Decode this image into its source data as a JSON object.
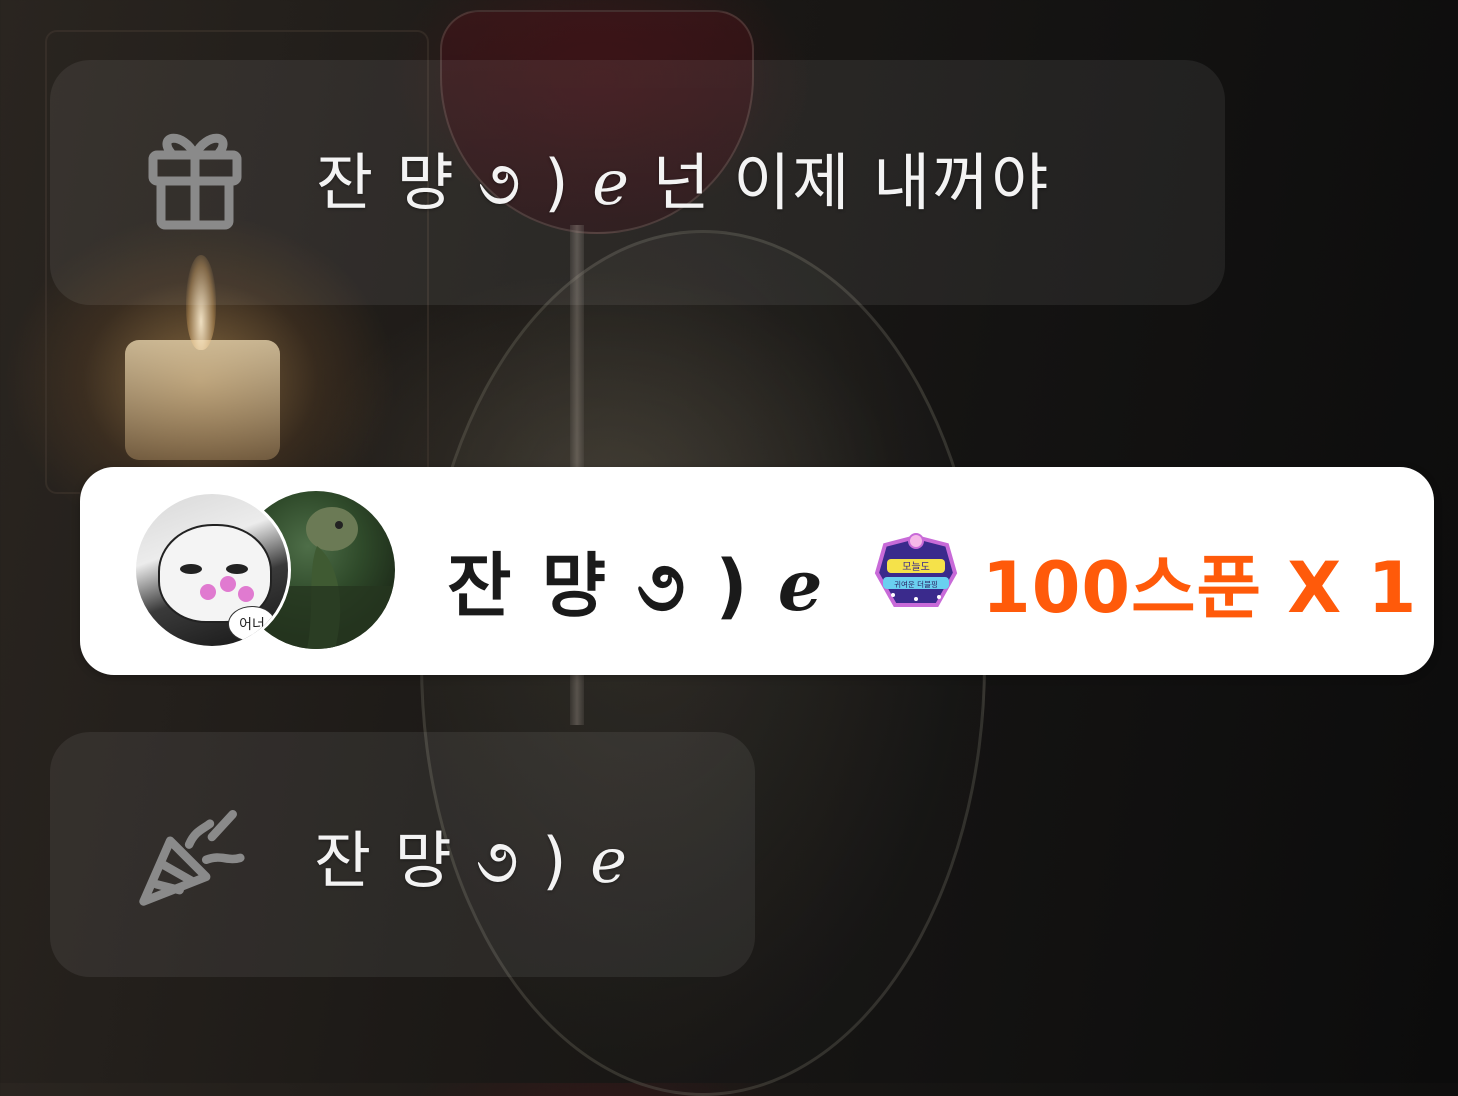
{
  "colors": {
    "accent_orange": "#ff5a0a",
    "card_bg": "#ffffff",
    "message_text": "#f3f3f3",
    "name_text": "#1a1a1a"
  },
  "gift_message": {
    "icon": "gift-icon",
    "text": "잔 먕 ૭ ) ℯ 넌 이제 내꺼야"
  },
  "gift_card": {
    "sender_avatar_text": "어너",
    "sender_name": "잔 먕 ૭ ) ℯ",
    "badge": {
      "icon": "gift-badge-icon",
      "line1": "모늘도",
      "line2": "귀여운 더블핑"
    },
    "amount": "100스푼 X 1"
  },
  "join_message": {
    "icon": "party-popper-icon",
    "text": "잔 먕 ૭ ) ℯ"
  }
}
